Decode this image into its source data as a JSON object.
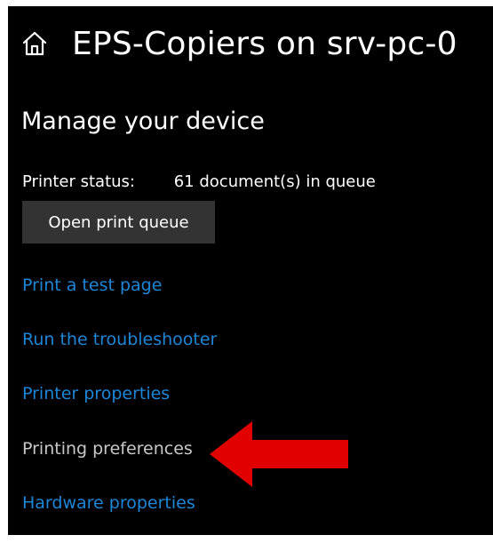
{
  "header": {
    "title": "EPS-Copiers on srv-pc-0",
    "icon": "home-icon"
  },
  "section": {
    "title": "Manage your device"
  },
  "status": {
    "label": "Printer status:",
    "value": "61 document(s) in queue"
  },
  "buttons": {
    "open_queue": "Open print queue"
  },
  "links": [
    {
      "label": "Print a test page"
    },
    {
      "label": "Run the troubleshooter"
    },
    {
      "label": "Printer properties"
    },
    {
      "label": "Printing preferences"
    },
    {
      "label": "Hardware properties"
    }
  ],
  "colors": {
    "background": "#000000",
    "link": "#1e86d9",
    "highlighted_link": "#c8c8c8",
    "button": "#333333",
    "arrow": "#e00000"
  }
}
